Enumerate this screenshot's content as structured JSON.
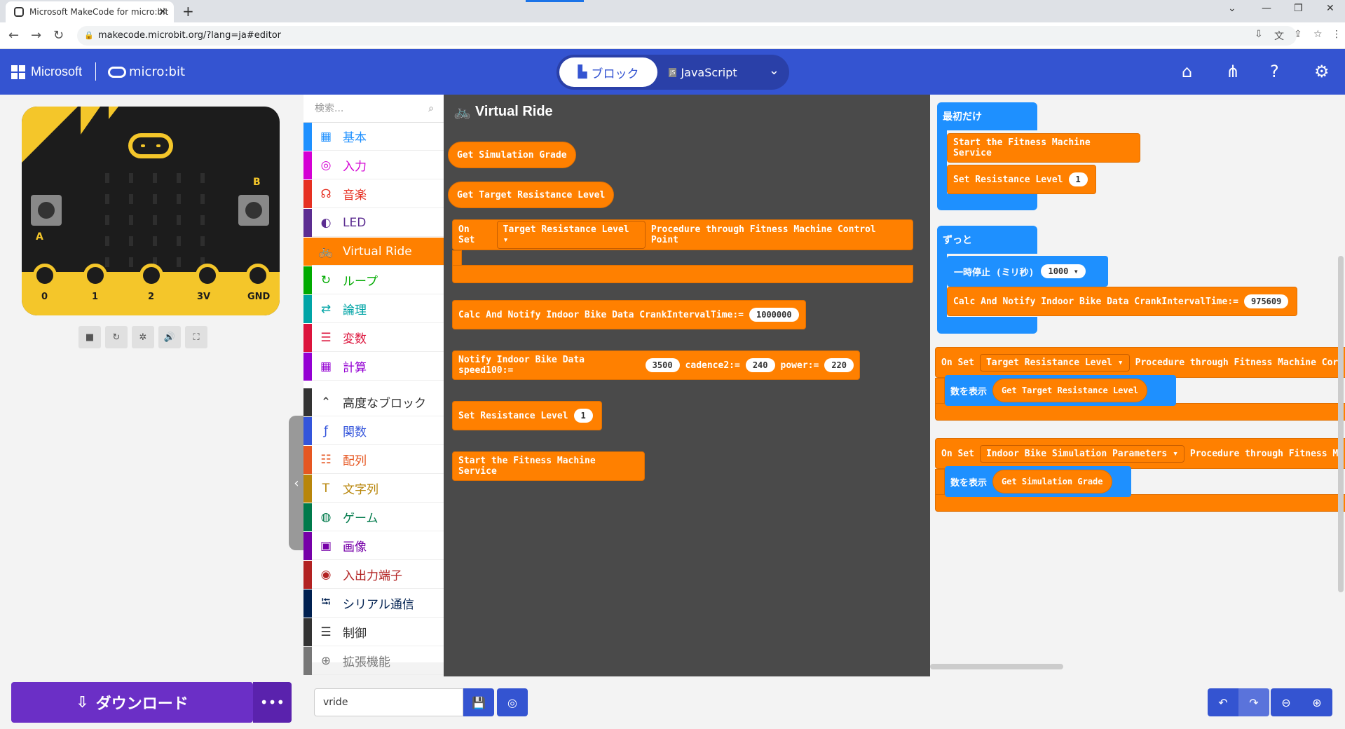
{
  "browser": {
    "tab_title": "Microsoft MakeCode for micro:bit",
    "url": "makecode.microbit.org/?lang=ja#editor"
  },
  "header": {
    "microsoft": "Microsoft",
    "microbit": "micro:bit",
    "blocks_label": "ブロック",
    "js_label": "JavaScript"
  },
  "board": {
    "btn_a": "A",
    "btn_b": "B",
    "pins": [
      "0",
      "1",
      "2",
      "3V",
      "GND"
    ]
  },
  "toolbox": {
    "search_placeholder": "検索...",
    "categories": [
      {
        "label": "基本",
        "color": "#1e90ff",
        "icon": "grid-icon"
      },
      {
        "label": "入力",
        "color": "#d400d4",
        "icon": "target-icon"
      },
      {
        "label": "音楽",
        "color": "#e63022",
        "icon": "headphones-icon"
      },
      {
        "label": "LED",
        "color": "#5c2d91",
        "icon": "toggle-icon"
      },
      {
        "label": "Virtual Ride",
        "color": "#ff8000",
        "icon": "bike-icon"
      },
      {
        "label": "ループ",
        "color": "#00aa00",
        "icon": "refresh-icon"
      },
      {
        "label": "論理",
        "color": "#00a4a6",
        "icon": "shuffle-icon"
      },
      {
        "label": "変数",
        "color": "#dc143c",
        "icon": "list-icon"
      },
      {
        "label": "計算",
        "color": "#9400d3",
        "icon": "calculator-icon"
      },
      {
        "label": "高度なブロック",
        "color": "#333333",
        "icon": "chevron-up-icon"
      },
      {
        "label": "関数",
        "color": "#3455db",
        "icon": "function-icon"
      },
      {
        "label": "配列",
        "color": "#e65722",
        "icon": "array-icon"
      },
      {
        "label": "文字列",
        "color": "#b8860b",
        "icon": "text-icon"
      },
      {
        "label": "ゲーム",
        "color": "#007a4b",
        "icon": "gamepad-icon"
      },
      {
        "label": "画像",
        "color": "#7600a8",
        "icon": "image-icon"
      },
      {
        "label": "入出力端子",
        "color": "#b22222",
        "icon": "pins-icon"
      },
      {
        "label": "シリアル通信",
        "color": "#002050",
        "icon": "usb-icon"
      },
      {
        "label": "制御",
        "color": "#333333",
        "icon": "control-icon"
      },
      {
        "label": "拡張機能",
        "color": "#777777",
        "icon": "plus-icon"
      }
    ]
  },
  "flyout": {
    "title": "Virtual Ride",
    "blocks": {
      "get_grade": "Get Simulation Grade",
      "get_target": "Get Target Resistance Level",
      "on_set_prefix": "On Set",
      "on_set_dd": "Target Resistance Level",
      "on_set_suffix": "Procedure through Fitness Machine Control Point",
      "calc": "Calc And Notify Indoor Bike Data CrankIntervalTime:=",
      "calc_val": "1000000",
      "notify": "Notify Indoor Bike Data speed100:=",
      "speed_val": "3500",
      "cadence": "cadence2:=",
      "cadence_val": "240",
      "power": "power:=",
      "power_val": "220",
      "set_res": "Set Resistance Level",
      "set_res_val": "1",
      "start": "Start the Fitness Machine Service"
    }
  },
  "workspace": {
    "on_start": "最初だけ",
    "start_service": "Start the Fitness Machine Service",
    "set_res": "Set Resistance Level",
    "set_res_val": "1",
    "forever": "ずっと",
    "pause": "一時停止 (ミリ秒)",
    "pause_val": "1000",
    "calc": "Calc And Notify Indoor Bike Data CrankIntervalTime:=",
    "calc_val": "975609",
    "on_set1_prefix": "On Set",
    "on_set1_dd": "Target Resistance Level",
    "on_set1_suffix": "Procedure through Fitness Machine Cor",
    "show_number": "数を表示",
    "get_target": "Get Target Resistance Level",
    "on_set2_prefix": "On Set",
    "on_set2_dd": "Indoor Bike Simulation Parameters",
    "on_set2_suffix": "Procedure through Fitness M",
    "show_number2": "数を表示",
    "get_grade": "Get Simulation Grade"
  },
  "bottom": {
    "download": "ダウンロード",
    "project_name": "vride"
  }
}
